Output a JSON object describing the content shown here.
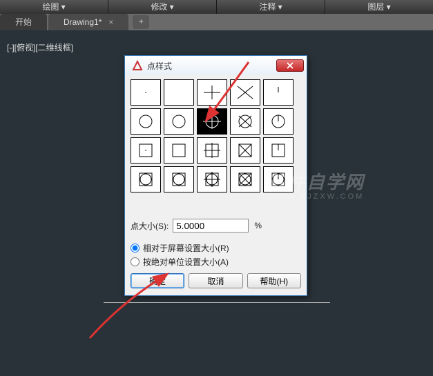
{
  "menubar": {
    "items": [
      "绘图 ▾",
      "修改 ▾",
      "注释 ▾",
      "图层 ▾"
    ]
  },
  "tabs": {
    "start": "开始",
    "doc": "Drawing1*",
    "close": "×",
    "plus": "+"
  },
  "view_label": "[-][俯视][二维线框]",
  "dialog": {
    "title": "点样式",
    "close_x": "X",
    "size_label": "点大小(S):",
    "size_value": "5.0000",
    "pct": "%",
    "radio1": "相对于屏幕设置大小(R)",
    "radio2": "按绝对单位设置大小(A)",
    "ok": "确定",
    "cancel": "取消",
    "help": "帮助(H)",
    "styles": {
      "rows": 4,
      "cols": 5,
      "selected_index": 7
    }
  },
  "watermark": {
    "line1": "软件自学网",
    "line2": "WWW.RJZXW.COM"
  },
  "colors": {
    "bg": "#283238",
    "dlg_border": "#3a7ab8",
    "accent": "#2a6db8"
  }
}
